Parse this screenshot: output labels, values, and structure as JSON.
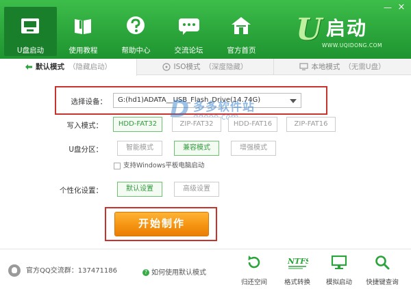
{
  "window": {
    "minimize_glyph": "—",
    "close_glyph": "×"
  },
  "nav": [
    {
      "label": "U盘启动",
      "icon": "usb-drive-icon",
      "active": true
    },
    {
      "label": "使用教程",
      "icon": "book-icon",
      "active": false
    },
    {
      "label": "帮助中心",
      "icon": "help-icon",
      "active": false
    },
    {
      "label": "交流论坛",
      "icon": "chat-icon",
      "active": false
    },
    {
      "label": "官方首页",
      "icon": "home-icon",
      "active": false
    }
  ],
  "logo": {
    "mark": "U",
    "text": "启动",
    "url": "WWW.UQIDONG.COM"
  },
  "tabs": [
    {
      "main": "默认模式",
      "sub": "（隐藏启动）",
      "icon": "arrows-icon",
      "active": true
    },
    {
      "main": "ISO模式",
      "sub": "（深度隐藏）",
      "icon": "disc-icon",
      "active": false
    },
    {
      "main": "本地模式",
      "sub": "（无需U盘）",
      "icon": "monitor-icon",
      "active": false
    }
  ],
  "form": {
    "device_label": "选择设备：",
    "device_value": "G:(hd1)ADATA__USB_Flash_Drive(14.74G)",
    "write_label": "写入模式：",
    "write_options": [
      "HDD-FAT32",
      "ZIP-FAT32",
      "HDD-FAT16",
      "ZIP-FAT16"
    ],
    "write_selected": 0,
    "partition_label": "U盘分区：",
    "partition_options": [
      "智能模式",
      "兼容模式",
      "增强模式"
    ],
    "partition_selected": 1,
    "tablet_checkbox_label": "支持Windows平板电脑启动",
    "personal_label": "个性化设置：",
    "personal_options": [
      "默认设置",
      "高级设置"
    ],
    "personal_selected": 0,
    "start_button": "开始制作"
  },
  "watermark": {
    "mark": "D",
    "text": "多多软件站",
    "url": "ddooo.com"
  },
  "footer": {
    "qq_label": "官方QQ交流群：137471186",
    "help_link": "如何使用默认模式",
    "help_glyph": "?",
    "tools": [
      {
        "label": "归还空间",
        "icon": "restore-icon"
      },
      {
        "label": "格式转换",
        "icon": "ntfs-icon",
        "icon_text": "NTFS"
      },
      {
        "label": "模拟启动",
        "icon": "simulate-icon"
      },
      {
        "label": "快捷键查询",
        "icon": "search-icon"
      }
    ]
  },
  "colors": {
    "header_green": "#2aa43a",
    "active_nav": "#1a7f2b",
    "highlight_red": "#c8322d",
    "start_orange": "#f59411",
    "selected_green": "#2e9a3a"
  }
}
